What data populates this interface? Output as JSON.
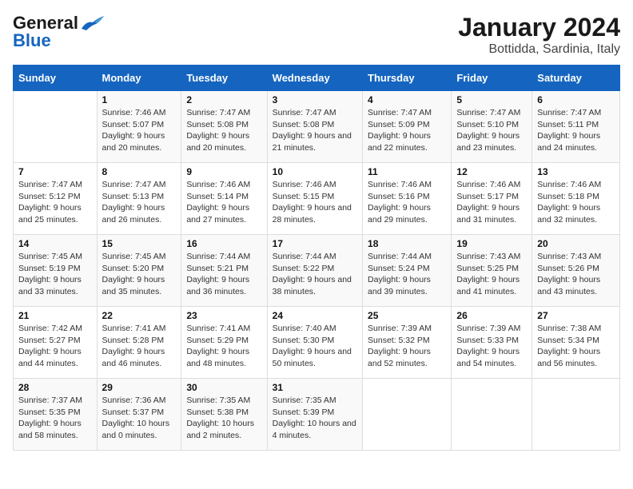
{
  "header": {
    "logo_general": "General",
    "logo_blue": "Blue",
    "month_title": "January 2024",
    "location": "Bottidda, Sardinia, Italy"
  },
  "days_of_week": [
    "Sunday",
    "Monday",
    "Tuesday",
    "Wednesday",
    "Thursday",
    "Friday",
    "Saturday"
  ],
  "weeks": [
    [
      {
        "day": "",
        "sunrise": "",
        "sunset": "",
        "daylight": ""
      },
      {
        "day": "1",
        "sunrise": "Sunrise: 7:46 AM",
        "sunset": "Sunset: 5:07 PM",
        "daylight": "Daylight: 9 hours and 20 minutes."
      },
      {
        "day": "2",
        "sunrise": "Sunrise: 7:47 AM",
        "sunset": "Sunset: 5:08 PM",
        "daylight": "Daylight: 9 hours and 20 minutes."
      },
      {
        "day": "3",
        "sunrise": "Sunrise: 7:47 AM",
        "sunset": "Sunset: 5:08 PM",
        "daylight": "Daylight: 9 hours and 21 minutes."
      },
      {
        "day": "4",
        "sunrise": "Sunrise: 7:47 AM",
        "sunset": "Sunset: 5:09 PM",
        "daylight": "Daylight: 9 hours and 22 minutes."
      },
      {
        "day": "5",
        "sunrise": "Sunrise: 7:47 AM",
        "sunset": "Sunset: 5:10 PM",
        "daylight": "Daylight: 9 hours and 23 minutes."
      },
      {
        "day": "6",
        "sunrise": "Sunrise: 7:47 AM",
        "sunset": "Sunset: 5:11 PM",
        "daylight": "Daylight: 9 hours and 24 minutes."
      }
    ],
    [
      {
        "day": "7",
        "sunrise": "Sunrise: 7:47 AM",
        "sunset": "Sunset: 5:12 PM",
        "daylight": "Daylight: 9 hours and 25 minutes."
      },
      {
        "day": "8",
        "sunrise": "Sunrise: 7:47 AM",
        "sunset": "Sunset: 5:13 PM",
        "daylight": "Daylight: 9 hours and 26 minutes."
      },
      {
        "day": "9",
        "sunrise": "Sunrise: 7:46 AM",
        "sunset": "Sunset: 5:14 PM",
        "daylight": "Daylight: 9 hours and 27 minutes."
      },
      {
        "day": "10",
        "sunrise": "Sunrise: 7:46 AM",
        "sunset": "Sunset: 5:15 PM",
        "daylight": "Daylight: 9 hours and 28 minutes."
      },
      {
        "day": "11",
        "sunrise": "Sunrise: 7:46 AM",
        "sunset": "Sunset: 5:16 PM",
        "daylight": "Daylight: 9 hours and 29 minutes."
      },
      {
        "day": "12",
        "sunrise": "Sunrise: 7:46 AM",
        "sunset": "Sunset: 5:17 PM",
        "daylight": "Daylight: 9 hours and 31 minutes."
      },
      {
        "day": "13",
        "sunrise": "Sunrise: 7:46 AM",
        "sunset": "Sunset: 5:18 PM",
        "daylight": "Daylight: 9 hours and 32 minutes."
      }
    ],
    [
      {
        "day": "14",
        "sunrise": "Sunrise: 7:45 AM",
        "sunset": "Sunset: 5:19 PM",
        "daylight": "Daylight: 9 hours and 33 minutes."
      },
      {
        "day": "15",
        "sunrise": "Sunrise: 7:45 AM",
        "sunset": "Sunset: 5:20 PM",
        "daylight": "Daylight: 9 hours and 35 minutes."
      },
      {
        "day": "16",
        "sunrise": "Sunrise: 7:44 AM",
        "sunset": "Sunset: 5:21 PM",
        "daylight": "Daylight: 9 hours and 36 minutes."
      },
      {
        "day": "17",
        "sunrise": "Sunrise: 7:44 AM",
        "sunset": "Sunset: 5:22 PM",
        "daylight": "Daylight: 9 hours and 38 minutes."
      },
      {
        "day": "18",
        "sunrise": "Sunrise: 7:44 AM",
        "sunset": "Sunset: 5:24 PM",
        "daylight": "Daylight: 9 hours and 39 minutes."
      },
      {
        "day": "19",
        "sunrise": "Sunrise: 7:43 AM",
        "sunset": "Sunset: 5:25 PM",
        "daylight": "Daylight: 9 hours and 41 minutes."
      },
      {
        "day": "20",
        "sunrise": "Sunrise: 7:43 AM",
        "sunset": "Sunset: 5:26 PM",
        "daylight": "Daylight: 9 hours and 43 minutes."
      }
    ],
    [
      {
        "day": "21",
        "sunrise": "Sunrise: 7:42 AM",
        "sunset": "Sunset: 5:27 PM",
        "daylight": "Daylight: 9 hours and 44 minutes."
      },
      {
        "day": "22",
        "sunrise": "Sunrise: 7:41 AM",
        "sunset": "Sunset: 5:28 PM",
        "daylight": "Daylight: 9 hours and 46 minutes."
      },
      {
        "day": "23",
        "sunrise": "Sunrise: 7:41 AM",
        "sunset": "Sunset: 5:29 PM",
        "daylight": "Daylight: 9 hours and 48 minutes."
      },
      {
        "day": "24",
        "sunrise": "Sunrise: 7:40 AM",
        "sunset": "Sunset: 5:30 PM",
        "daylight": "Daylight: 9 hours and 50 minutes."
      },
      {
        "day": "25",
        "sunrise": "Sunrise: 7:39 AM",
        "sunset": "Sunset: 5:32 PM",
        "daylight": "Daylight: 9 hours and 52 minutes."
      },
      {
        "day": "26",
        "sunrise": "Sunrise: 7:39 AM",
        "sunset": "Sunset: 5:33 PM",
        "daylight": "Daylight: 9 hours and 54 minutes."
      },
      {
        "day": "27",
        "sunrise": "Sunrise: 7:38 AM",
        "sunset": "Sunset: 5:34 PM",
        "daylight": "Daylight: 9 hours and 56 minutes."
      }
    ],
    [
      {
        "day": "28",
        "sunrise": "Sunrise: 7:37 AM",
        "sunset": "Sunset: 5:35 PM",
        "daylight": "Daylight: 9 hours and 58 minutes."
      },
      {
        "day": "29",
        "sunrise": "Sunrise: 7:36 AM",
        "sunset": "Sunset: 5:37 PM",
        "daylight": "Daylight: 10 hours and 0 minutes."
      },
      {
        "day": "30",
        "sunrise": "Sunrise: 7:35 AM",
        "sunset": "Sunset: 5:38 PM",
        "daylight": "Daylight: 10 hours and 2 minutes."
      },
      {
        "day": "31",
        "sunrise": "Sunrise: 7:35 AM",
        "sunset": "Sunset: 5:39 PM",
        "daylight": "Daylight: 10 hours and 4 minutes."
      },
      {
        "day": "",
        "sunrise": "",
        "sunset": "",
        "daylight": ""
      },
      {
        "day": "",
        "sunrise": "",
        "sunset": "",
        "daylight": ""
      },
      {
        "day": "",
        "sunrise": "",
        "sunset": "",
        "daylight": ""
      }
    ]
  ]
}
